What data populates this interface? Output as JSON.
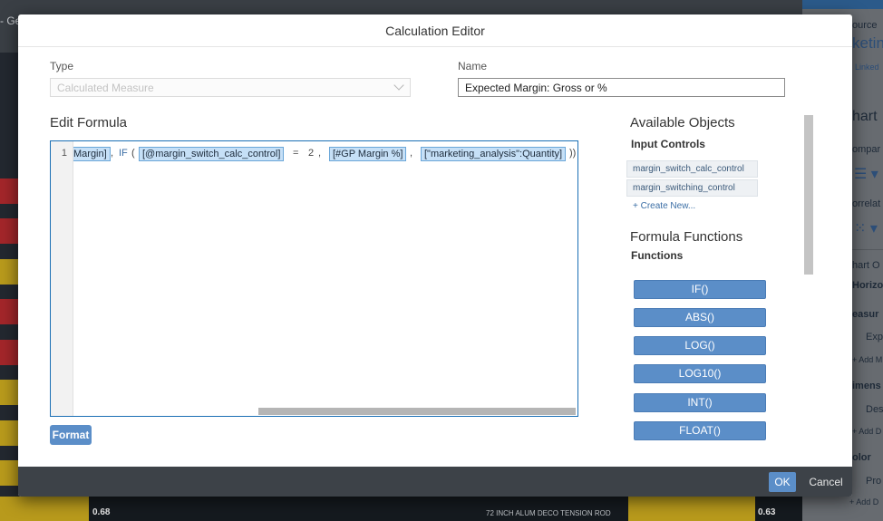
{
  "background": {
    "top_tab_fragment": "- Ge",
    "bottom_values": [
      "0.68",
      "0.63"
    ],
    "bottom_label": "72 INCH ALUM DECO TENSION ROD",
    "right_panel": {
      "source_fragment": "ource",
      "title_fragment": "keting",
      "linked_fragment": "Linked",
      "chart_fragment": "hart",
      "compare_fragment": "ompar",
      "correlation_fragment": "orrelat",
      "chart_orientation_fragment": "hart O",
      "horizontal_fragment": "Horizo",
      "measures_fragment": "easur",
      "measure_item_fragment": "Exp",
      "add_measure_fragment": "+ Add M",
      "dimensions_fragment": "imens",
      "dimension_item_fragment": "Des",
      "add_dimension_fragment": "+ Add D",
      "color_fragment": "olor",
      "color_item_fragment": "Pro",
      "add_color_fragment": "+ Add D"
    }
  },
  "dialog": {
    "title": "Calculation Editor",
    "type": {
      "label": "Type",
      "value": "Calculated Measure"
    },
    "name": {
      "label": "Name",
      "value": "Expected Margin: Gross or %"
    },
    "edit_formula": {
      "title": "Edit Formula",
      "line_number": "1",
      "tokens": {
        "t0": "Margin]",
        "t1": ",",
        "t2": "IF",
        "t3": "(",
        "t4": "[@margin_switch_calc_control]",
        "t5": "=",
        "t6": "2",
        "t7": ",",
        "t8": "[#GP Margin %]",
        "t9": ",",
        "t10": "[\"marketing_analysis\":Quantity]",
        "t11": "))"
      }
    },
    "format_button": "Format",
    "available_objects": {
      "title": "Available Objects",
      "input_controls_title": "Input Controls",
      "input_controls": [
        "margin_switch_calc_control",
        "margin_switching_control"
      ],
      "create_new": "+ Create New..."
    },
    "formula_functions": {
      "title": "Formula Functions",
      "functions_title": "Functions",
      "functions": [
        "IF()",
        "ABS()",
        "LOG()",
        "LOG10()",
        "INT()",
        "FLOAT()"
      ]
    },
    "footer": {
      "ok": "OK",
      "cancel": "Cancel"
    }
  },
  "colors": {
    "accent": "#5b8ec8",
    "editor_border": "#1a6fb5",
    "token_fill": "#c6e0f7",
    "footer_bg": "#3d4248"
  }
}
